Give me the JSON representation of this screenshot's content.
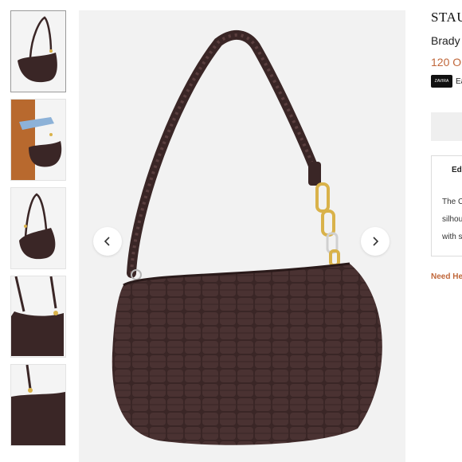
{
  "gallery": {
    "thumbnails": [
      {
        "alt": "bag-front-view"
      },
      {
        "alt": "bag-worn-on-arm"
      },
      {
        "alt": "bag-angle-view"
      },
      {
        "alt": "bag-interior-view"
      },
      {
        "alt": "bag-detail-view"
      }
    ],
    "selected_index": 0,
    "bag_color": "#3a2626",
    "prev_icon": "chevron-left-icon",
    "next_icon": "chevron-right-icon"
  },
  "product": {
    "brand": "STAU",
    "name": "Brady",
    "price": "120 O",
    "payment_badge_text": "ZAVIRA",
    "payment_text": "Ea",
    "editor": {
      "title": "Edi",
      "lines": [
        "The C",
        "silhou",
        "with s"
      ]
    },
    "help_link": "Need He"
  },
  "colors": {
    "accent": "#c0673a",
    "bag": "#3a2626",
    "gold": "#d9b24a"
  }
}
